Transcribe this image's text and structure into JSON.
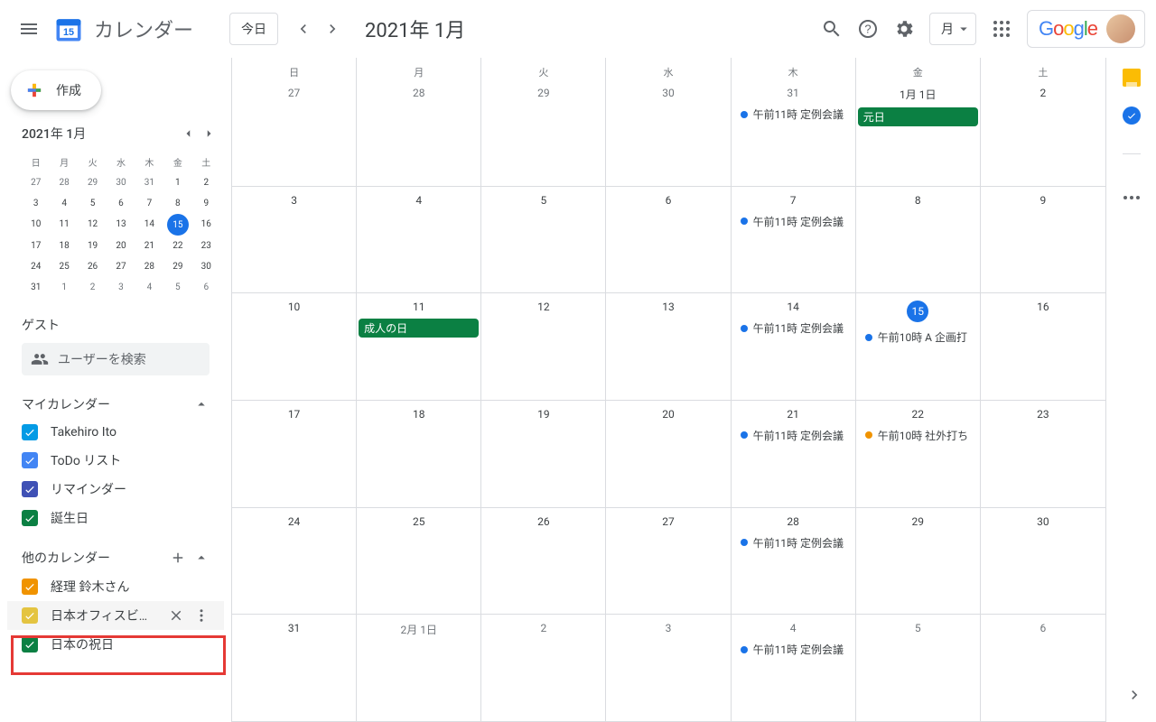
{
  "header": {
    "app_name": "カレンダー",
    "today_btn": "今日",
    "period": "2021年 1月",
    "view_label": "月",
    "google_label": "Google"
  },
  "sidebar": {
    "create": "作成",
    "mini_cal": {
      "title": "2021年 1月",
      "dayheaders": [
        "日",
        "月",
        "火",
        "水",
        "木",
        "金",
        "土"
      ],
      "weeks": [
        [
          {
            "d": "27",
            "m": true
          },
          {
            "d": "28",
            "m": true
          },
          {
            "d": "29",
            "m": true
          },
          {
            "d": "30",
            "m": true
          },
          {
            "d": "31",
            "m": true
          },
          {
            "d": "1"
          },
          {
            "d": "2"
          }
        ],
        [
          {
            "d": "3"
          },
          {
            "d": "4"
          },
          {
            "d": "5"
          },
          {
            "d": "6"
          },
          {
            "d": "7"
          },
          {
            "d": "8"
          },
          {
            "d": "9"
          }
        ],
        [
          {
            "d": "10"
          },
          {
            "d": "11"
          },
          {
            "d": "12"
          },
          {
            "d": "13"
          },
          {
            "d": "14"
          },
          {
            "d": "15",
            "today": true
          },
          {
            "d": "16"
          }
        ],
        [
          {
            "d": "17"
          },
          {
            "d": "18"
          },
          {
            "d": "19"
          },
          {
            "d": "20"
          },
          {
            "d": "21"
          },
          {
            "d": "22"
          },
          {
            "d": "23"
          }
        ],
        [
          {
            "d": "24"
          },
          {
            "d": "25"
          },
          {
            "d": "26"
          },
          {
            "d": "27"
          },
          {
            "d": "28"
          },
          {
            "d": "29"
          },
          {
            "d": "30"
          }
        ],
        [
          {
            "d": "31"
          },
          {
            "d": "1",
            "m": true
          },
          {
            "d": "2",
            "m": true
          },
          {
            "d": "3",
            "m": true
          },
          {
            "d": "4",
            "m": true
          },
          {
            "d": "5",
            "m": true
          },
          {
            "d": "6",
            "m": true
          }
        ]
      ]
    },
    "guest_title": "ゲスト",
    "search_placeholder": "ユーザーを検索",
    "my_cal_title": "マイカレンダー",
    "my_cals": [
      {
        "label": "Takehiro Ito",
        "color": "#039be5"
      },
      {
        "label": "ToDo リスト",
        "color": "#4285f4"
      },
      {
        "label": "リマインダー",
        "color": "#3f51b5"
      },
      {
        "label": "誕生日",
        "color": "#0b8043"
      }
    ],
    "other_cal_title": "他のカレンダー",
    "other_cals": [
      {
        "label": "経理 鈴木さん",
        "color": "#f09300",
        "hl": false
      },
      {
        "label": "日本オフィスビ…",
        "color": "#e4c441",
        "hl": true
      },
      {
        "label": "日本の祝日",
        "color": "#0b8043",
        "hl": false
      }
    ]
  },
  "grid": {
    "dayheaders": [
      "日",
      "月",
      "火",
      "水",
      "木",
      "金",
      "土"
    ],
    "cells": [
      {
        "num": "27",
        "muted": true
      },
      {
        "num": "28",
        "muted": true
      },
      {
        "num": "29",
        "muted": true
      },
      {
        "num": "30",
        "muted": true
      },
      {
        "num": "31",
        "muted": true,
        "events": [
          {
            "type": "dot",
            "color": "blue",
            "text": "午前11時 定例会議"
          }
        ]
      },
      {
        "num": "1月 1日",
        "events": [
          {
            "type": "block",
            "color": "green",
            "text": "元日"
          }
        ]
      },
      {
        "num": "2"
      },
      {
        "num": "3"
      },
      {
        "num": "4"
      },
      {
        "num": "5"
      },
      {
        "num": "6"
      },
      {
        "num": "7",
        "events": [
          {
            "type": "dot",
            "color": "blue",
            "text": "午前11時 定例会議"
          }
        ]
      },
      {
        "num": "8"
      },
      {
        "num": "9"
      },
      {
        "num": "10"
      },
      {
        "num": "11",
        "events": [
          {
            "type": "block",
            "color": "green",
            "text": "成人の日"
          }
        ]
      },
      {
        "num": "12"
      },
      {
        "num": "13"
      },
      {
        "num": "14",
        "events": [
          {
            "type": "dot",
            "color": "blue",
            "text": "午前11時 定例会議"
          }
        ]
      },
      {
        "num": "15",
        "today": true,
        "events": [
          {
            "type": "dot",
            "color": "blue",
            "text": "午前10時 A 企画打"
          }
        ]
      },
      {
        "num": "16"
      },
      {
        "num": "17"
      },
      {
        "num": "18"
      },
      {
        "num": "19"
      },
      {
        "num": "20"
      },
      {
        "num": "21",
        "events": [
          {
            "type": "dot",
            "color": "blue",
            "text": "午前11時 定例会議"
          }
        ]
      },
      {
        "num": "22",
        "events": [
          {
            "type": "dot",
            "color": "orange",
            "text": "午前10時 社外打ち"
          }
        ]
      },
      {
        "num": "23"
      },
      {
        "num": "24"
      },
      {
        "num": "25"
      },
      {
        "num": "26"
      },
      {
        "num": "27"
      },
      {
        "num": "28",
        "events": [
          {
            "type": "dot",
            "color": "blue",
            "text": "午前11時 定例会議"
          }
        ]
      },
      {
        "num": "29"
      },
      {
        "num": "30"
      },
      {
        "num": "31"
      },
      {
        "num": "2月 1日",
        "muted": true
      },
      {
        "num": "2",
        "muted": true
      },
      {
        "num": "3",
        "muted": true
      },
      {
        "num": "4",
        "muted": true,
        "events": [
          {
            "type": "dot",
            "color": "blue",
            "text": "午前11時 定例会議"
          }
        ]
      },
      {
        "num": "5",
        "muted": true
      },
      {
        "num": "6",
        "muted": true
      }
    ]
  }
}
